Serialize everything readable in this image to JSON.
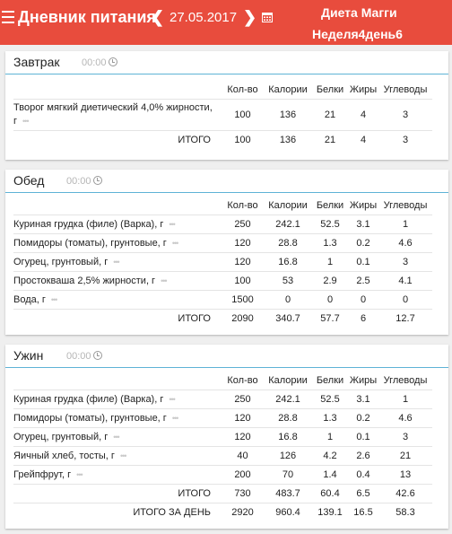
{
  "header": {
    "title": "Дневник питания",
    "date": "27.05.2017",
    "diet_name": "Диета Магги",
    "week_day": "Неделя4день6",
    "bg_color": "#e84c3d"
  },
  "columns": {
    "qty": "Кол-во",
    "calories": "Калории",
    "protein": "Белки",
    "fat": "Жиры",
    "carbs": "Углеводы"
  },
  "meals": [
    {
      "name": "Завтрак",
      "time": "00:00",
      "items": [
        {
          "name": "Творог мягкий диетический 4,0% жирности, г",
          "qty": "100",
          "cal": "136",
          "prot": "21",
          "fat": "4",
          "carb": "3"
        }
      ],
      "total": {
        "label": "ИТОГО",
        "qty": "100",
        "cal": "136",
        "prot": "21",
        "fat": "4",
        "carb": "3"
      }
    },
    {
      "name": "Обед",
      "time": "00:00",
      "items": [
        {
          "name": "Куриная грудка (филе) (Варка), г",
          "qty": "250",
          "cal": "242.1",
          "prot": "52.5",
          "fat": "3.1",
          "carb": "1"
        },
        {
          "name": "Помидоры (томаты), грунтовые, г",
          "qty": "120",
          "cal": "28.8",
          "prot": "1.3",
          "fat": "0.2",
          "carb": "4.6"
        },
        {
          "name": "Огурец, грунтовый, г",
          "qty": "120",
          "cal": "16.8",
          "prot": "1",
          "fat": "0.1",
          "carb": "3"
        },
        {
          "name": "Простокваша 2,5% жирности, г",
          "qty": "100",
          "cal": "53",
          "prot": "2.9",
          "fat": "2.5",
          "carb": "4.1"
        },
        {
          "name": "Вода, г",
          "qty": "1500",
          "cal": "0",
          "prot": "0",
          "fat": "0",
          "carb": "0"
        }
      ],
      "total": {
        "label": "ИТОГО",
        "qty": "2090",
        "cal": "340.7",
        "prot": "57.7",
        "fat": "6",
        "carb": "12.7"
      }
    },
    {
      "name": "Ужин",
      "time": "00:00",
      "items": [
        {
          "name": "Куриная грудка (филе) (Варка), г",
          "qty": "250",
          "cal": "242.1",
          "prot": "52.5",
          "fat": "3.1",
          "carb": "1"
        },
        {
          "name": "Помидоры (томаты), грунтовые, г",
          "qty": "120",
          "cal": "28.8",
          "prot": "1.3",
          "fat": "0.2",
          "carb": "4.6"
        },
        {
          "name": "Огурец, грунтовый, г",
          "qty": "120",
          "cal": "16.8",
          "prot": "1",
          "fat": "0.1",
          "carb": "3"
        },
        {
          "name": "Яичный хлеб, тосты, г",
          "qty": "40",
          "cal": "126",
          "prot": "4.2",
          "fat": "2.6",
          "carb": "21"
        },
        {
          "name": "Грейпфрут, г",
          "qty": "200",
          "cal": "70",
          "prot": "1.4",
          "fat": "0.4",
          "carb": "13"
        }
      ],
      "total": {
        "label": "ИТОГО",
        "qty": "730",
        "cal": "483.7",
        "prot": "60.4",
        "fat": "6.5",
        "carb": "42.6"
      }
    }
  ],
  "day_total": {
    "label": "ИТОГО ЗА ДЕНЬ",
    "qty": "2920",
    "cal": "960.4",
    "prot": "139.1",
    "fat": "16.5",
    "carb": "58.3"
  }
}
